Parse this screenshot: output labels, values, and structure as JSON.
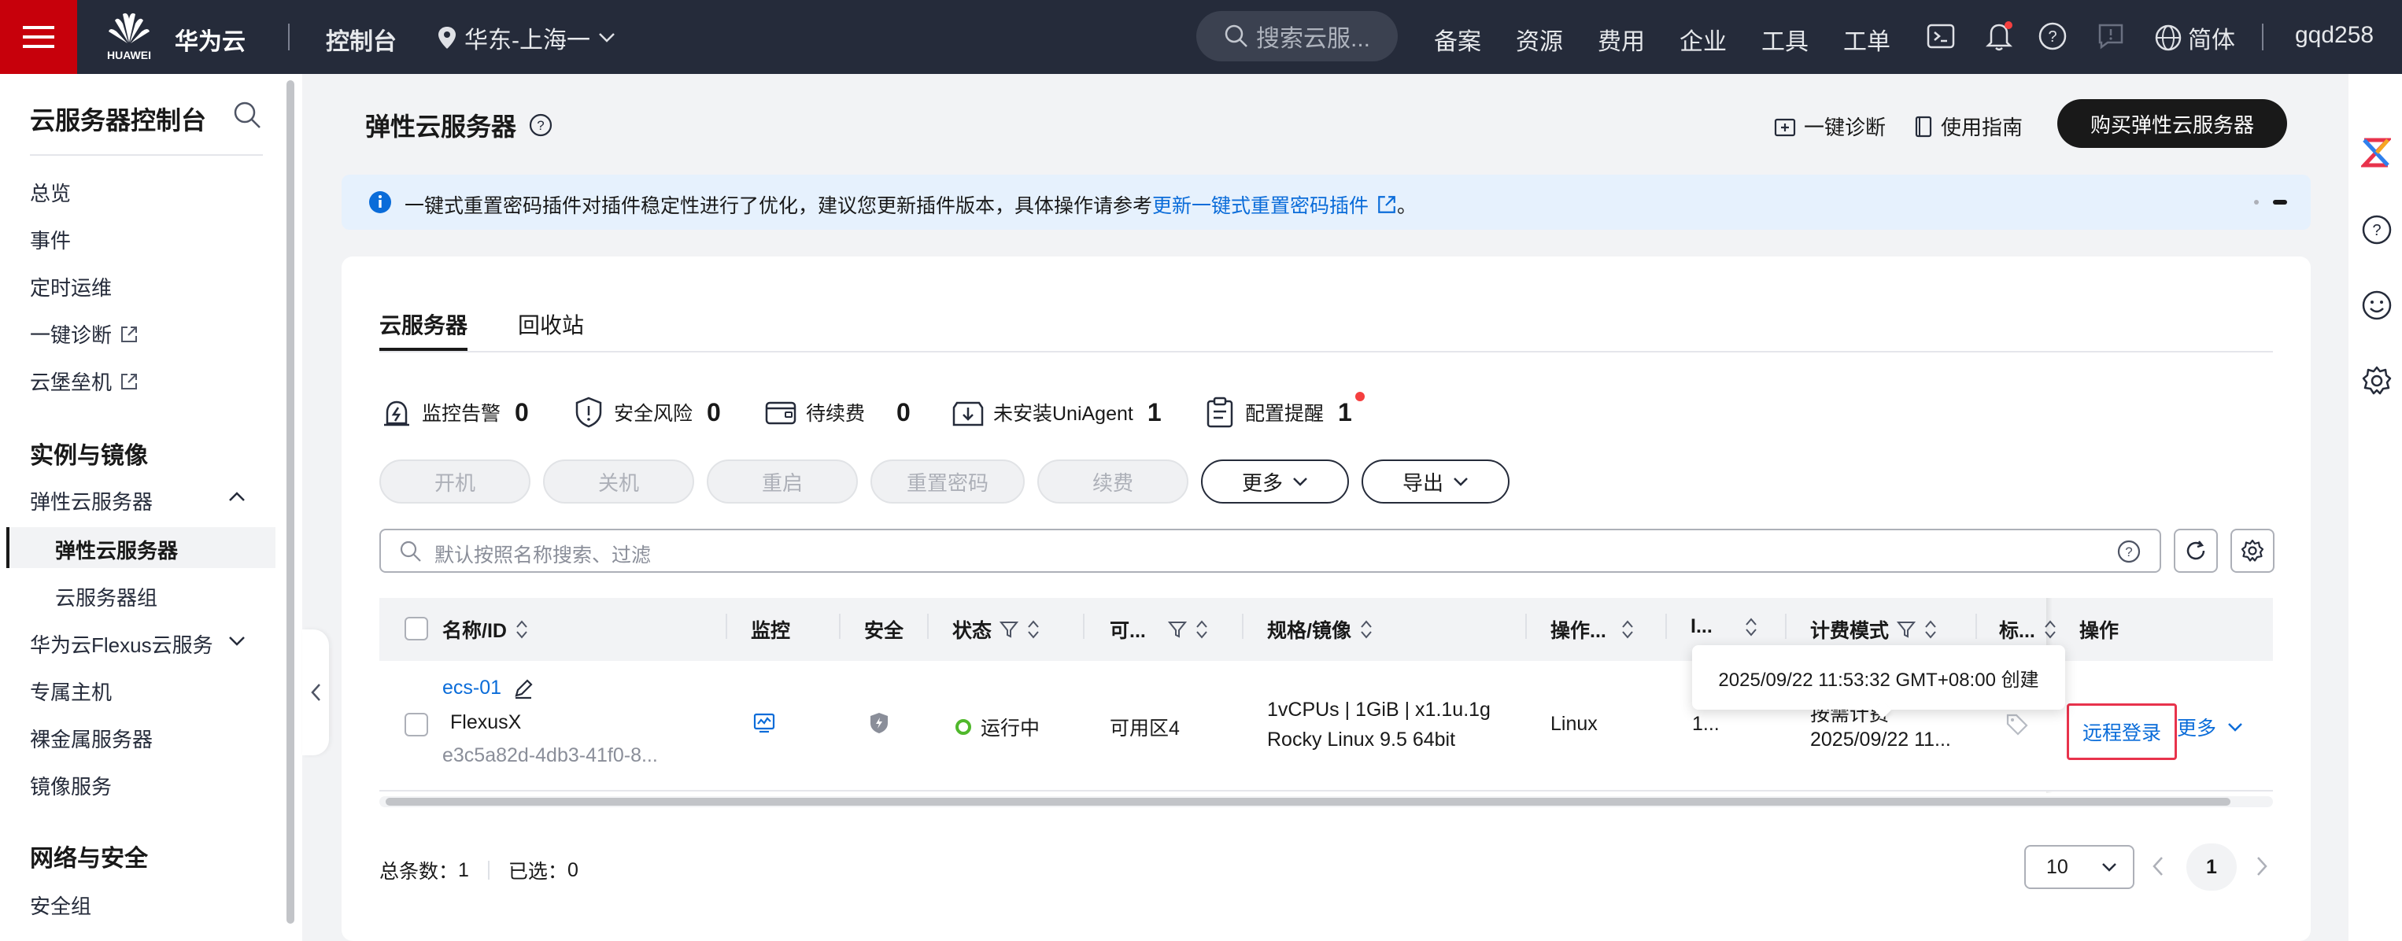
{
  "topbar": {
    "logo_text": "HUAWEI",
    "brand": "华为云",
    "console": "控制台",
    "region": "华东-上海一",
    "search_placeholder": "搜索云服...",
    "nav": [
      "备案",
      "资源",
      "费用",
      "企业",
      "工具",
      "工单"
    ],
    "language": "简体",
    "username": "gqd258"
  },
  "sidebar": {
    "title": "云服务器控制台",
    "items_top": [
      "总览",
      "事件",
      "定时运维",
      "一键诊断",
      "云堡垒机"
    ],
    "group_instances": "实例与镜像",
    "ecs_parent": "弹性云服务器",
    "ecs_child": "弹性云服务器",
    "ecs_group": "云服务器组",
    "flexus": "华为云Flexus云服务",
    "items_more": [
      "专属主机",
      "裸金属服务器",
      "镜像服务"
    ],
    "group_network": "网络与安全",
    "security_group": "安全组"
  },
  "page": {
    "title": "弹性云服务器",
    "diagnose": "一键诊断",
    "guide": "使用指南",
    "buy": "购买弹性云服务器"
  },
  "notice": {
    "text": "一键式重置密码插件对插件稳定性进行了优化，建议您更新插件版本，具体操作请参考",
    "link": "更新一键式重置密码插件",
    "end": "。"
  },
  "tabs": [
    "云服务器",
    "回收站"
  ],
  "stats": [
    {
      "label": "监控告警",
      "value": "0"
    },
    {
      "label": "安全风险",
      "value": "0"
    },
    {
      "label": "待续费",
      "value": "0"
    },
    {
      "label": "未安装UniAgent",
      "value": "1"
    },
    {
      "label": "配置提醒",
      "value": "1"
    }
  ],
  "actions": {
    "disabled": [
      "开机",
      "关机",
      "重启",
      "重置密码",
      "续费"
    ],
    "more": "更多",
    "export": "导出"
  },
  "filter_placeholder": "默认按照名称搜索、过滤",
  "table": {
    "headers": {
      "name": "名称/ID",
      "monitor": "监控",
      "security": "安全",
      "status": "状态",
      "az": "可...",
      "spec": "规格/镜像",
      "os": "操作...",
      "ip": "I...",
      "billing": "计费模式",
      "tags": "标...",
      "ops": "操作"
    },
    "row": {
      "name": "ecs-01",
      "type": "FlexusX",
      "id": "e3c5a82d-4db3-41f0-8...",
      "status": "运行中",
      "az": "可用区4",
      "spec": "1vCPUs | 1GiB | x1.1u.1g",
      "image": "Rocky Linux 9.5 64bit",
      "os": "Linux",
      "ip": "1...",
      "billing_mode": "按需计费",
      "billing_time": "2025/09/22 11...",
      "remote_login": "远程登录",
      "more": "更多"
    }
  },
  "tooltip": "2025/09/22 11:53:32 GMT+08:00 创建",
  "footer": {
    "total_label": "总条数：",
    "total": "1",
    "selected_label": "已选：",
    "selected": "0",
    "page_size": "10",
    "page": "1"
  },
  "colors": {
    "accent": "#0a6cd9",
    "brand_red": "#c7000b",
    "running": "#50b82c"
  }
}
